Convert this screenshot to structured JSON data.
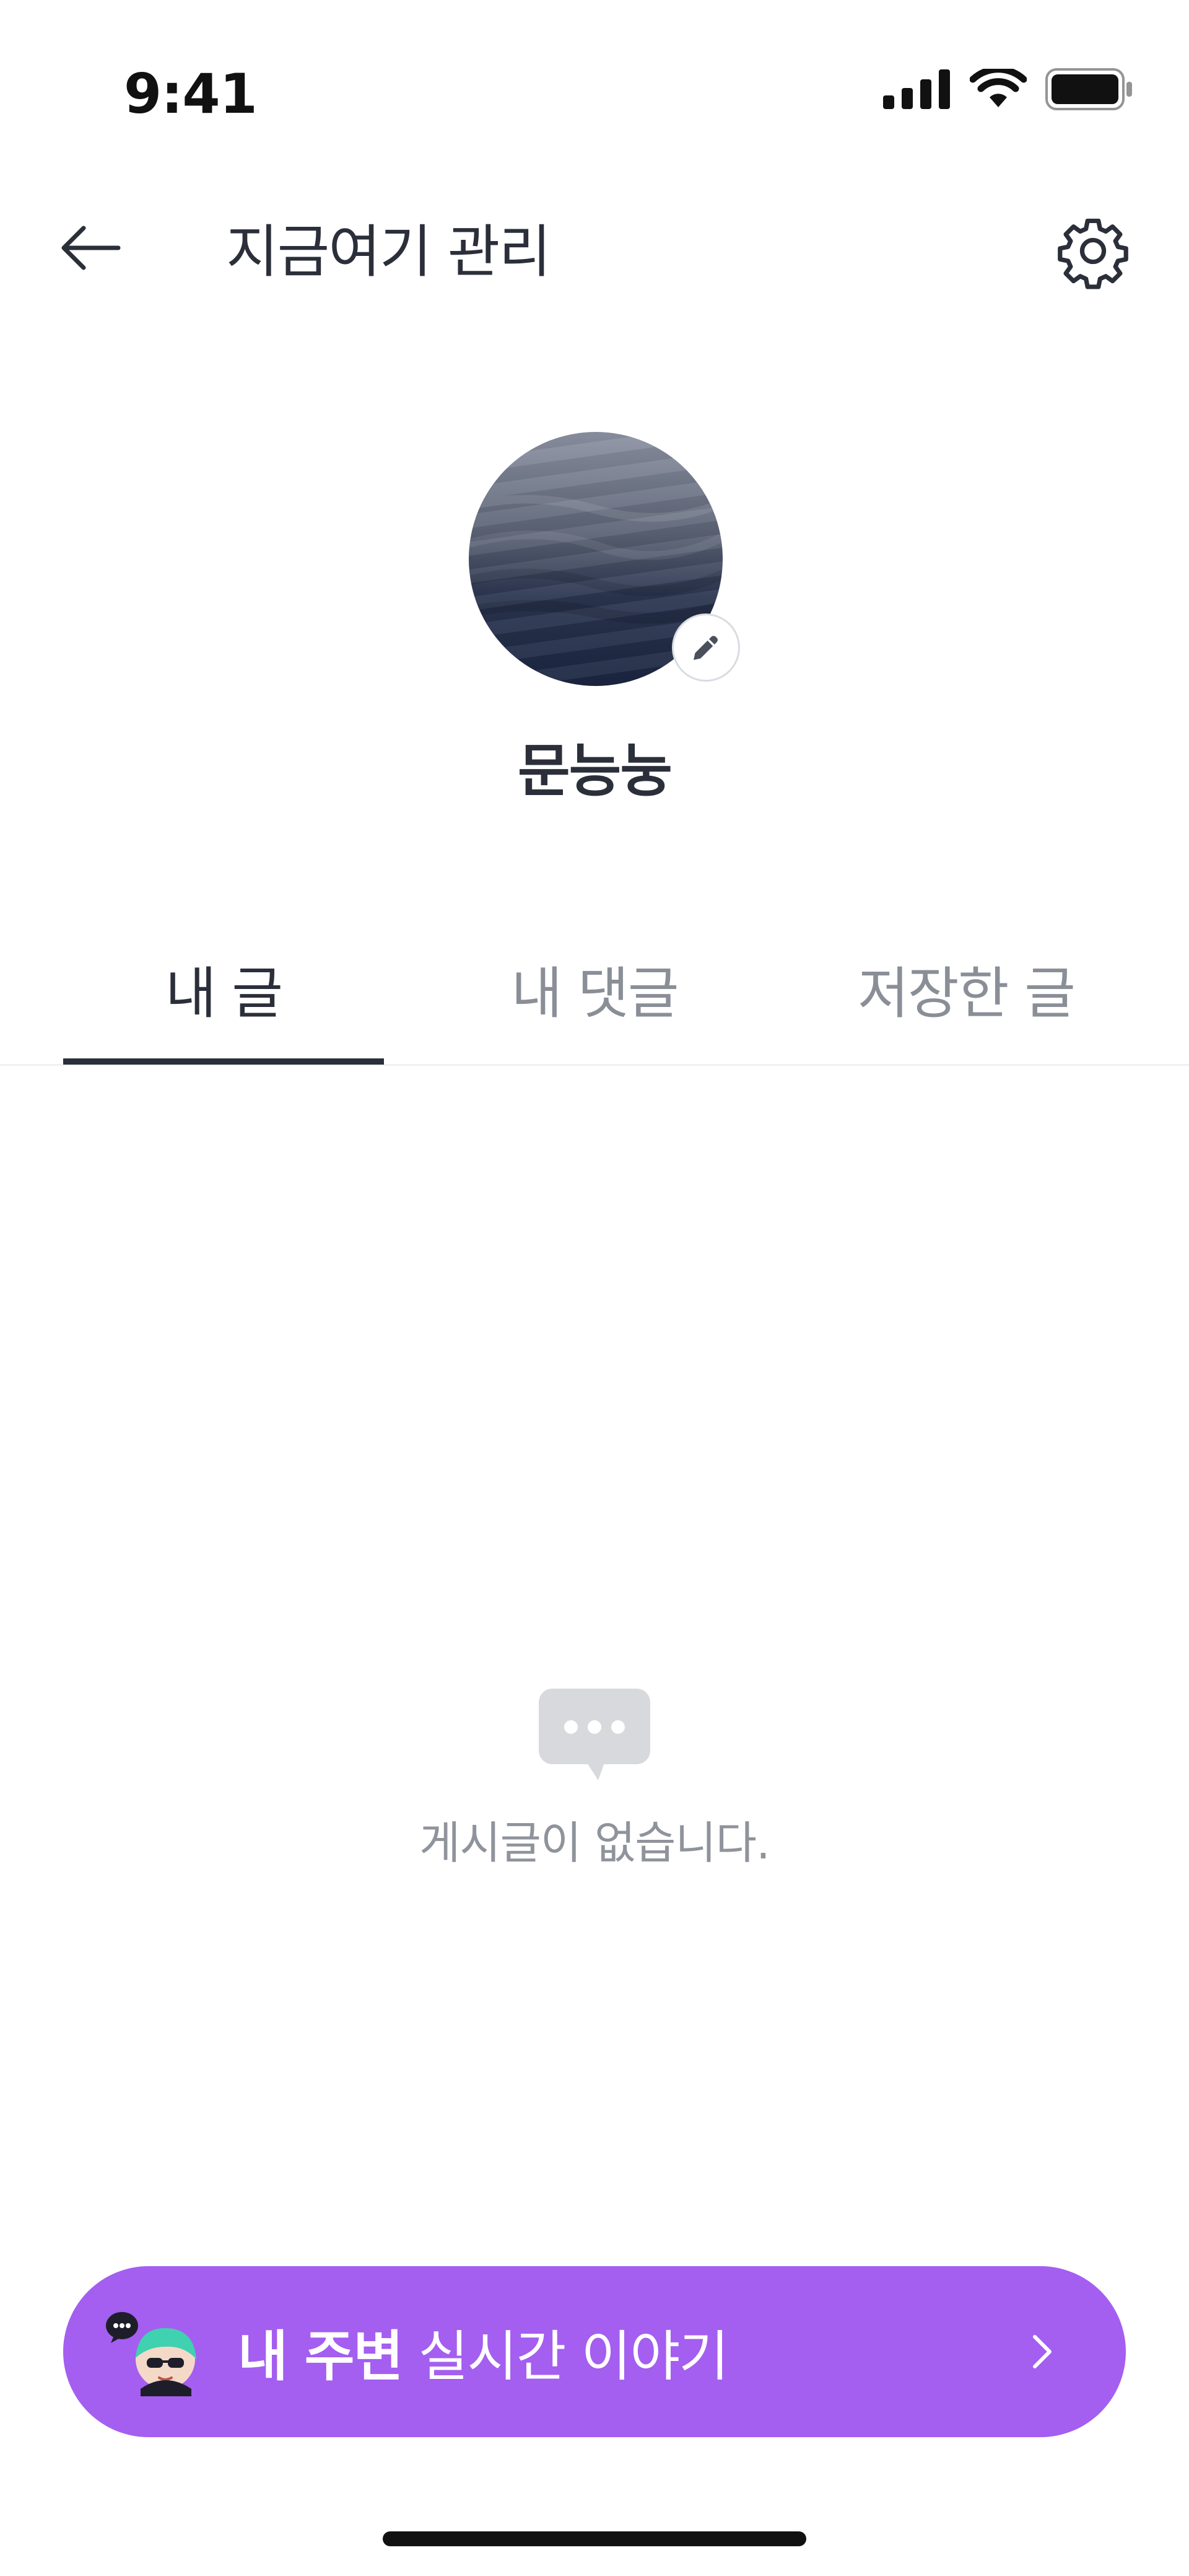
{
  "status_bar": {
    "time": "9:41"
  },
  "header": {
    "title": "지금여기 관리",
    "back_icon": "arrow-left-icon",
    "settings_icon": "gear-icon"
  },
  "profile": {
    "nickname": "문능눙",
    "edit_icon": "pencil-icon"
  },
  "tabs": [
    {
      "label": "내 글",
      "selected": true
    },
    {
      "label": "내 댓글",
      "selected": false
    },
    {
      "label": "저장한 글",
      "selected": false
    }
  ],
  "empty_state": {
    "icon": "speech-bubble-icon",
    "message": "게시글이 없습니다."
  },
  "banner": {
    "bold_text": "내 주변",
    "text": "실시간 이야기",
    "icon": "chevron-right-icon"
  },
  "colors": {
    "text_primary": "#2b2f3a",
    "text_secondary": "#8a8e97",
    "banner_bg": "#a45ef0",
    "tab_indicator": "#2b2f3a",
    "empty_icon": "#d8d9dc"
  }
}
